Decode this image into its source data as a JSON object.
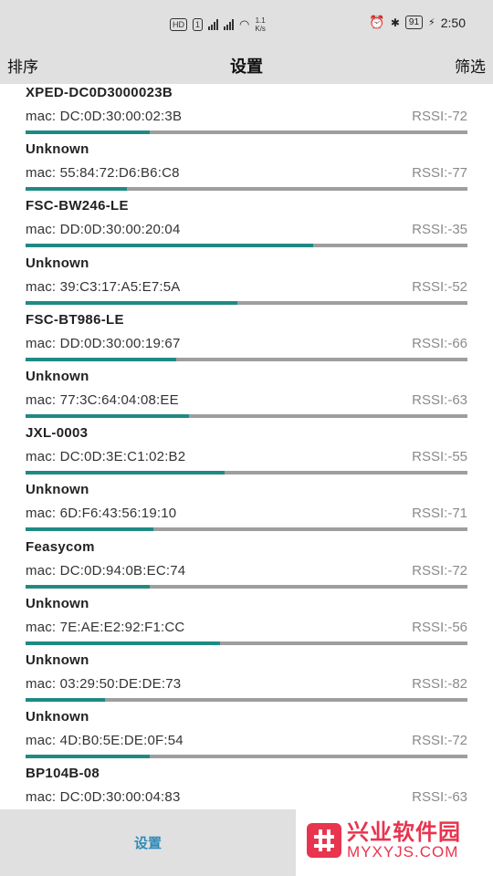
{
  "status_bar": {
    "hd_label": "HD",
    "sim_label": "1",
    "net_speed": "1.1\nK/s",
    "battery": "91",
    "time": "2:50"
  },
  "toolbar": {
    "sort_label": "排序",
    "title": "设置",
    "filter_label": "筛选"
  },
  "devices": [
    {
      "name": "XPED-DC0D3000023B",
      "mac": "mac: DC:0D:30:00:02:3B",
      "rssi_label": "RSSI:-72",
      "rssi": -72
    },
    {
      "name": "Unknown",
      "mac": "mac: 55:84:72:D6:B6:C8",
      "rssi_label": "RSSI:-77",
      "rssi": -77
    },
    {
      "name": "FSC-BW246-LE",
      "mac": "mac: DD:0D:30:00:20:04",
      "rssi_label": "RSSI:-35",
      "rssi": -35
    },
    {
      "name": "Unknown",
      "mac": "mac: 39:C3:17:A5:E7:5A",
      "rssi_label": "RSSI:-52",
      "rssi": -52
    },
    {
      "name": "FSC-BT986-LE",
      "mac": "mac: DD:0D:30:00:19:67",
      "rssi_label": "RSSI:-66",
      "rssi": -66
    },
    {
      "name": "Unknown",
      "mac": "mac: 77:3C:64:04:08:EE",
      "rssi_label": "RSSI:-63",
      "rssi": -63
    },
    {
      "name": "JXL-0003",
      "mac": "mac: DC:0D:3E:C1:02:B2",
      "rssi_label": "RSSI:-55",
      "rssi": -55
    },
    {
      "name": "Unknown",
      "mac": "mac: 6D:F6:43:56:19:10",
      "rssi_label": "RSSI:-71",
      "rssi": -71
    },
    {
      "name": "Feasycom",
      "mac": "mac: DC:0D:94:0B:EC:74",
      "rssi_label": "RSSI:-72",
      "rssi": -72
    },
    {
      "name": "Unknown",
      "mac": "mac: 7E:AE:E2:92:F1:CC",
      "rssi_label": "RSSI:-56",
      "rssi": -56
    },
    {
      "name": "Unknown",
      "mac": "mac: 03:29:50:DE:DE:73",
      "rssi_label": "RSSI:-82",
      "rssi": -82
    },
    {
      "name": "Unknown",
      "mac": "mac: 4D:B0:5E:DE:0F:54",
      "rssi_label": "RSSI:-72",
      "rssi": -72
    },
    {
      "name": "BP104B-08",
      "mac": "mac: DC:0D:30:00:04:83",
      "rssi_label": "RSSI:-63",
      "rssi": -63
    }
  ],
  "bottom_nav": {
    "settings_label": "设置"
  },
  "watermark": {
    "cn": "兴业软件园",
    "en": "MYXYJS.COM"
  },
  "colors": {
    "bar_fill": "#1f8a84",
    "bar_track": "#9e9e9e",
    "nav_accent": "#2e8bb8",
    "header_bg": "#e0e0e0",
    "watermark": "#e8344e"
  }
}
